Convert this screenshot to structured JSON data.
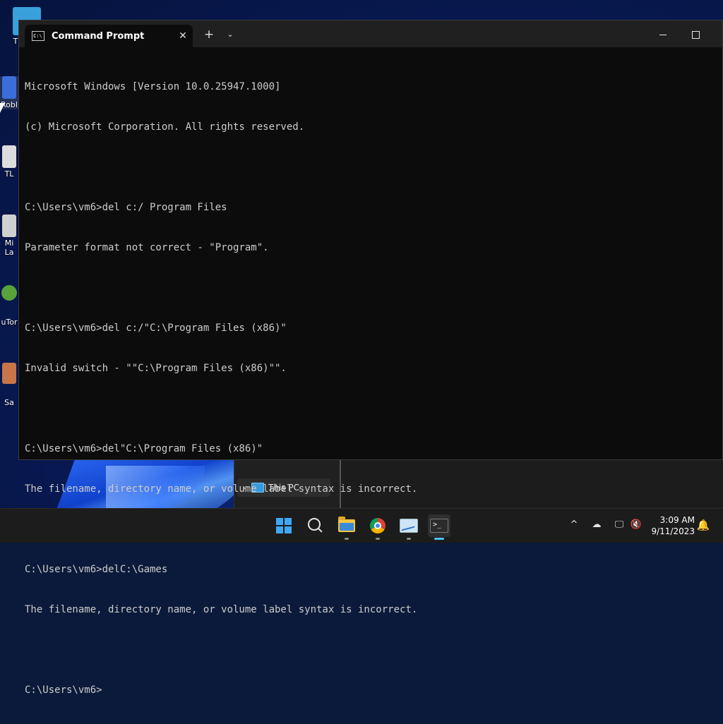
{
  "desktop": {
    "icons": [
      {
        "label": "T",
        "color": "#3aa0dc"
      },
      {
        "label": "Robl",
        "color": "#3b6ed8"
      },
      {
        "label": "TL",
        "color": "#dddddd"
      },
      {
        "label": "Mi",
        "sub": "La",
        "color": "#d0d0d0"
      },
      {
        "label": "uTor",
        "color": "#57a33a"
      },
      {
        "label": "Sa",
        "color": "#c8754a"
      }
    ]
  },
  "explorer": {
    "nav_item_label": "This PC",
    "chevron": "›"
  },
  "window": {
    "tab_title": "Command Prompt",
    "tab_icon_text": "C:\\",
    "close_glyph": "✕",
    "new_tab_glyph": "+",
    "dropdown_glyph": "⌄"
  },
  "console": {
    "lines": [
      "Microsoft Windows [Version 10.0.25947.1000]",
      "(c) Microsoft Corporation. All rights reserved.",
      "",
      "C:\\Users\\vm6>del c:/ Program Files",
      "Parameter format not correct - \"Program\".",
      "",
      "C:\\Users\\vm6>del c:/\"C:\\Program Files (x86)\"",
      "Invalid switch - \"\"C:\\Program Files (x86)\"\".",
      "",
      "C:\\Users\\vm6>del\"C:\\Program Files (x86)\"",
      "The filename, directory name, or volume label syntax is incorrect.",
      "",
      "C:\\Users\\vm6>delC:\\Games",
      "The filename, directory name, or volume label syntax is incorrect.",
      "",
      "C:\\Users\\vm6>"
    ]
  },
  "taskbar": {
    "clock_time": "3:09 AM",
    "clock_date": "9/11/2023",
    "accent_color": "#4cc2ff",
    "tray": {
      "overflow_glyph": "^",
      "onedrive_glyph": "☁",
      "network_glyph": "🖵",
      "volume_glyph": "🔇",
      "bell_glyph": "🔔"
    },
    "terminal_icon_text": ">_"
  }
}
